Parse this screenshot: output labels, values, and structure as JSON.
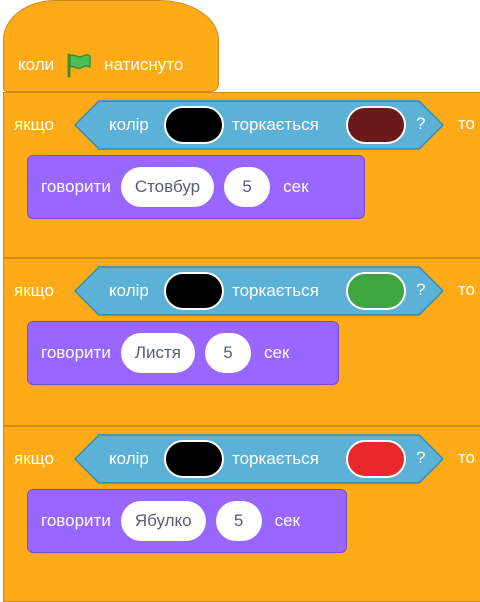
{
  "event": {
    "when_label": "коли",
    "clicked_label": "натиснуто",
    "flag_icon": "green-flag-icon"
  },
  "blocks": [
    {
      "if_label": "якщо",
      "then_label": "то",
      "color_label": "колір",
      "touching_label": "торкається",
      "question_mark": "?",
      "color1": "#000000",
      "color2": "#6b1a1a",
      "say_label": "говорити",
      "message": "Стовбур",
      "seconds": "5",
      "sec_label": "сек"
    },
    {
      "if_label": "якщо",
      "then_label": "то",
      "color_label": "колір",
      "touching_label": "торкається",
      "question_mark": "?",
      "color1": "#000000",
      "color2": "#3fa53f",
      "say_label": "говорити",
      "message": "Листя",
      "seconds": "5",
      "sec_label": "сек"
    },
    {
      "if_label": "якщо",
      "then_label": "то",
      "color_label": "колір",
      "touching_label": "торкається",
      "question_mark": "?",
      "color1": "#000000",
      "color2": "#e8282b",
      "say_label": "говорити",
      "message": "Ябулко",
      "seconds": "5",
      "sec_label": "сек"
    }
  ],
  "colors": {
    "control": "#ffab19",
    "sensing": "#5cb1d6",
    "looks": "#9966ff"
  }
}
